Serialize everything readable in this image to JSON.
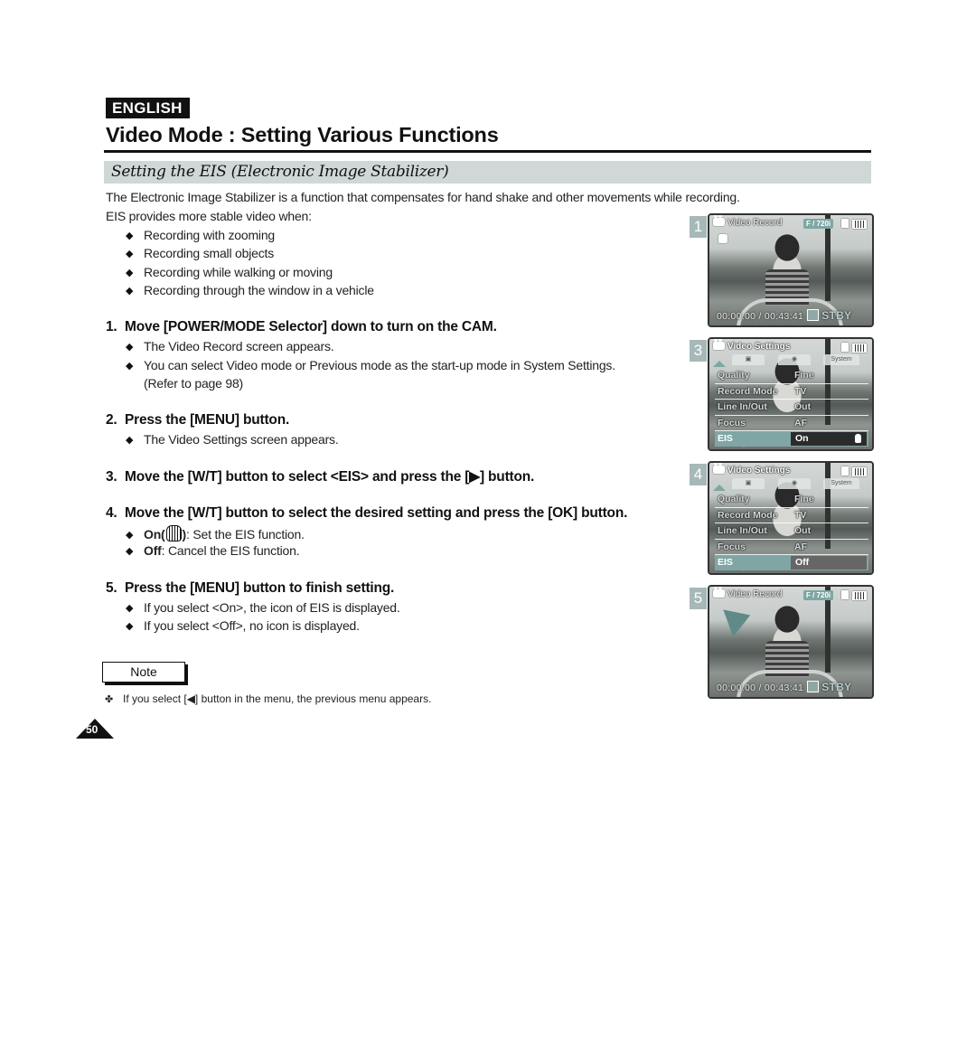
{
  "header": {
    "language": "ENGLISH",
    "title": "Video Mode : Setting Various Functions",
    "section": "Setting the EIS (Electronic Image Stabilizer)"
  },
  "intro": {
    "line1": "The Electronic Image Stabilizer is a function that compensates for hand shake and other movements while recording.",
    "line2": "EIS provides more stable video when:",
    "bullets": [
      "Recording with zooming",
      "Recording small objects",
      "Recording while walking or moving",
      "Recording through the window in a vehicle"
    ]
  },
  "steps": [
    {
      "number": "1.",
      "text": "Move [POWER/MODE Selector] down to turn on the CAM.",
      "bullets": [
        "The Video Record screen appears.",
        "You can select Video mode or Previous mode as the start-up mode in System Settings."
      ],
      "continuation": "(Refer to page 98)"
    },
    {
      "number": "2.",
      "text": "Press the [MENU] button.",
      "bullets": [
        "The Video Settings screen appears."
      ]
    },
    {
      "number": "3.",
      "text": "Move the [W/T] button to select <EIS> and press the [▶] button."
    },
    {
      "number": "4.",
      "text": "Move the [W/T] button to select the desired setting and press the [OK] button.",
      "options": [
        {
          "term": "On(",
          "term_close": ")",
          "icon": "eis-hand-icon",
          "desc": ": Set the EIS function."
        },
        {
          "term": "Off",
          "desc": ": Cancel the EIS function."
        }
      ]
    },
    {
      "number": "5.",
      "text": "Press the [MENU] button to finish setting.",
      "bullets": [
        "If you select <On>, the icon of EIS is displayed.",
        "If you select <Off>, no icon is displayed."
      ]
    }
  ],
  "note": {
    "label": "Note",
    "text": "If you select [◀] button in the menu, the previous menu appears."
  },
  "page_number": "50",
  "screens": [
    {
      "step": "1",
      "type": "record",
      "title": "Video Record",
      "quality": "F / 720i",
      "timecode": "00:00:00 / 00:43:41",
      "status": "STBY",
      "eis_icon": true
    },
    {
      "step": "3",
      "type": "menu",
      "title": "Video Settings",
      "tabs": [
        "video-tab",
        "camera-tab",
        "System"
      ],
      "rows": [
        {
          "label": "Quality",
          "value": "Fine"
        },
        {
          "label": "Record Mode",
          "value": "TV"
        },
        {
          "label": "Line In/Out",
          "value": "Out"
        },
        {
          "label": "Focus",
          "value": "AF"
        },
        {
          "label": "EIS",
          "value": "On",
          "selected": true
        }
      ]
    },
    {
      "step": "4",
      "type": "menu",
      "title": "Video Settings",
      "tabs": [
        "video-tab",
        "camera-tab",
        "System"
      ],
      "rows": [
        {
          "label": "Quality",
          "value": "Fine"
        },
        {
          "label": "Record Mode",
          "value": "TV"
        },
        {
          "label": "Line In/Out",
          "value": "Out"
        },
        {
          "label": "Focus",
          "value": "AF"
        },
        {
          "label": "EIS",
          "value": "Off",
          "selected": true
        }
      ]
    },
    {
      "step": "5",
      "type": "record",
      "title": "Video Record",
      "quality": "F / 720i",
      "timecode": "00:00:00 / 00:43:41",
      "status": "STBY",
      "eis_icon": false
    }
  ],
  "colors": {
    "section_bar": "#cfd7d7",
    "accent_teal": "#7fa6a4",
    "step_badge": "#a7b8b8"
  }
}
